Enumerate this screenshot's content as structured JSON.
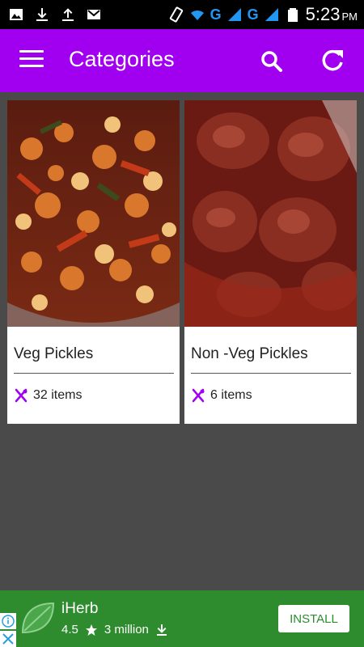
{
  "status_bar": {
    "icons": [
      "image-icon",
      "download-icon",
      "upload-icon",
      "mail-icon",
      "rotate-icon",
      "wifi-icon",
      "signal-icon",
      "battery-icon"
    ],
    "network_1": "G",
    "network_2": "G",
    "time": "5:23",
    "ampm": "PM"
  },
  "app_bar": {
    "title": "Categories",
    "background": "#a100f0"
  },
  "categories": [
    {
      "title": "Veg Pickles",
      "count": "32 items"
    },
    {
      "title": "Non -Veg Pickles",
      "count": "6 items"
    }
  ],
  "ad": {
    "app_name": "iHerb",
    "rating": "4.5",
    "downloads": "3 million",
    "install_label": "INSTALL",
    "background": "#2e8b2e"
  },
  "colors": {
    "accent": "#a100f0",
    "content_bg": "#4a4a4a"
  }
}
